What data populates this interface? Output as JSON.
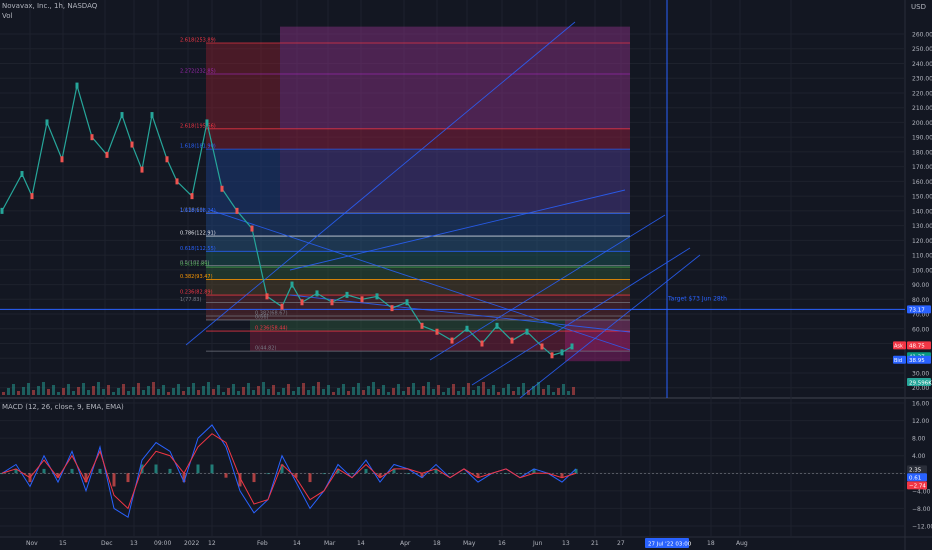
{
  "header": {
    "symbol_line": "Novavax, Inc., 1h, NASDAQ",
    "volume_label": "Vol",
    "macd_label": "MACD (12, 26, close, 9, EMA, EMA)",
    "currency": "USD"
  },
  "chart_data": [
    {
      "type": "line",
      "title": "Novavax, Inc., 1h, NASDAQ",
      "ylabel": "USD",
      "ylim": [
        20,
        265
      ],
      "yticks": [
        260,
        250,
        240,
        230,
        220,
        210,
        200,
        190,
        180,
        170,
        160,
        150,
        140,
        130,
        120,
        110,
        100,
        90,
        80,
        70,
        60,
        50,
        40,
        30,
        20
      ],
      "x_ticks": [
        "Nov",
        "15",
        "Dec",
        "13",
        "09:00",
        "2022",
        "12",
        "Feb",
        "14",
        "Mar",
        "14",
        "Apr",
        "18",
        "May",
        "16",
        "Jun",
        "13",
        "21",
        "27",
        "Jul",
        "18",
        "Aug"
      ],
      "time_badge": "27 Jul '22  03:00",
      "price_path": [
        {
          "t": 0.0,
          "p": 140
        },
        {
          "t": 2.0,
          "p": 165
        },
        {
          "t": 3.0,
          "p": 150
        },
        {
          "t": 4.5,
          "p": 200
        },
        {
          "t": 6.0,
          "p": 175
        },
        {
          "t": 7.5,
          "p": 225
        },
        {
          "t": 9.0,
          "p": 190
        },
        {
          "t": 10.5,
          "p": 178
        },
        {
          "t": 12.0,
          "p": 205
        },
        {
          "t": 13.0,
          "p": 185
        },
        {
          "t": 14.0,
          "p": 168
        },
        {
          "t": 15.0,
          "p": 205
        },
        {
          "t": 16.5,
          "p": 175
        },
        {
          "t": 17.5,
          "p": 160
        },
        {
          "t": 19.0,
          "p": 150
        },
        {
          "t": 20.5,
          "p": 200
        },
        {
          "t": 22.0,
          "p": 155
        },
        {
          "t": 23.5,
          "p": 140
        },
        {
          "t": 25.0,
          "p": 128
        },
        {
          "t": 26.5,
          "p": 82
        },
        {
          "t": 28.0,
          "p": 75
        },
        {
          "t": 29.0,
          "p": 90
        },
        {
          "t": 30.0,
          "p": 78
        },
        {
          "t": 31.5,
          "p": 84
        },
        {
          "t": 33.0,
          "p": 78
        },
        {
          "t": 34.5,
          "p": 83
        },
        {
          "t": 36.0,
          "p": 80
        },
        {
          "t": 37.5,
          "p": 82
        },
        {
          "t": 39.0,
          "p": 74
        },
        {
          "t": 40.5,
          "p": 78
        },
        {
          "t": 42.0,
          "p": 62
        },
        {
          "t": 43.5,
          "p": 58
        },
        {
          "t": 45.0,
          "p": 52
        },
        {
          "t": 46.5,
          "p": 60
        },
        {
          "t": 48.0,
          "p": 50
        },
        {
          "t": 49.5,
          "p": 62
        },
        {
          "t": 51.0,
          "p": 52
        },
        {
          "t": 52.5,
          "p": 58
        },
        {
          "t": 54.0,
          "p": 48
        },
        {
          "t": 55.0,
          "p": 42
        },
        {
          "t": 56.0,
          "p": 44
        },
        {
          "t": 57.0,
          "p": 48
        }
      ],
      "fib_levels": [
        {
          "label": "2.618(253.89)",
          "price": 253.89,
          "color": "#f23645"
        },
        {
          "label": "2.272(232.85)",
          "price": 232.85,
          "color": "#9c27b0"
        },
        {
          "label": "2.618(195.66)",
          "price": 195.66,
          "color": "#f23645"
        },
        {
          "label": "1.618(181.90)",
          "price": 181.9,
          "color": "#2962ff"
        },
        {
          "label": "1(138.60)",
          "price": 138.6,
          "color": "#787b86"
        },
        {
          "label": "1.618(138.24)",
          "price": 138.24,
          "color": "#2962ff"
        },
        {
          "label": "0.786(122.91)",
          "price": 122.91,
          "color": "#e0e3eb"
        },
        {
          "label": "0.618(112.55)",
          "price": 112.55,
          "color": "#2962ff"
        },
        {
          "label": "0.5(102.88)",
          "price": 102.88,
          "color": "#787b86"
        },
        {
          "label": "0.5(101.89)",
          "price": 101.89,
          "color": "#4caf50"
        },
        {
          "label": "0.382(93.47)",
          "price": 93.47,
          "color": "#ff9800"
        },
        {
          "label": "0.236(82.89)",
          "price": 82.89,
          "color": "#f23645"
        },
        {
          "label": "1(77.83)",
          "price": 77.83,
          "color": "#787b86"
        },
        {
          "label": "0.382(68.67)",
          "price": 68.67,
          "color": "#787b86"
        },
        {
          "label": "0(66)",
          "price": 66,
          "color": "#787b86"
        },
        {
          "label": "0.236(58.44)",
          "price": 58.44,
          "color": "#f23645"
        },
        {
          "label": "0(44.82)",
          "price": 44.82,
          "color": "#787b86"
        }
      ],
      "annotations": [
        {
          "text": "Target $73 Jun 28th",
          "color": "#2962ff"
        }
      ],
      "horizontal_line": 73.17,
      "price_badges": [
        {
          "text": "73.17",
          "color": "#2962ff"
        },
        {
          "text": "48.75",
          "color": "#f23645",
          "tag": "Ask"
        },
        {
          "text": "41.37",
          "color": "#089981"
        },
        {
          "text": "38.95",
          "color": "#2962ff",
          "tag": "Bid"
        },
        {
          "text": "29.596K",
          "color": "#26a69a"
        }
      ],
      "vertical_marker_time": "27 Jul '22  03:00"
    },
    {
      "type": "line",
      "title": "MACD (12, 26, close, 9, EMA, EMA)",
      "ylim": [
        -16,
        16
      ],
      "yticks": [
        16.0,
        12.0,
        8.0,
        4.0,
        0.0,
        -4.0,
        -8.0,
        -12.0
      ],
      "tick_labels": [
        "16.00",
        "12.00",
        "8.00",
        "4.00",
        "0.00",
        "−4.00",
        "−8.00",
        "−12.00"
      ],
      "series": [
        {
          "values": [
            0,
            2,
            -3,
            4,
            -2,
            5,
            -4,
            6,
            -8,
            -10,
            3,
            7,
            5,
            -2,
            8,
            11,
            6,
            -4,
            -9,
            -6,
            4,
            -2,
            -8,
            -4,
            2,
            -1,
            3,
            -2,
            2,
            1,
            -1,
            2,
            -1,
            1,
            -2,
            0,
            1,
            -1,
            1,
            0,
            -2,
            1
          ]
        },
        {
          "values": [
            0,
            1,
            -1,
            3,
            -1,
            4,
            -2,
            5,
            -5,
            -8,
            1,
            5,
            4,
            0,
            6,
            9,
            7,
            -1,
            -7,
            -6,
            2,
            -1,
            -6,
            -4,
            1,
            -1,
            2,
            -1,
            1,
            1,
            0,
            1,
            -1,
            1,
            -1,
            0,
            1,
            -1,
            0,
            0,
            -1,
            0
          ]
        }
      ],
      "macd_badges": [
        {
          "text": "2.35",
          "color": "#b2b5be"
        },
        {
          "text": "0.61",
          "color": "#2962ff"
        },
        {
          "text": "−2.74",
          "color": "#f23645"
        }
      ]
    }
  ],
  "time_badge": "27 Jul '22  03:00"
}
